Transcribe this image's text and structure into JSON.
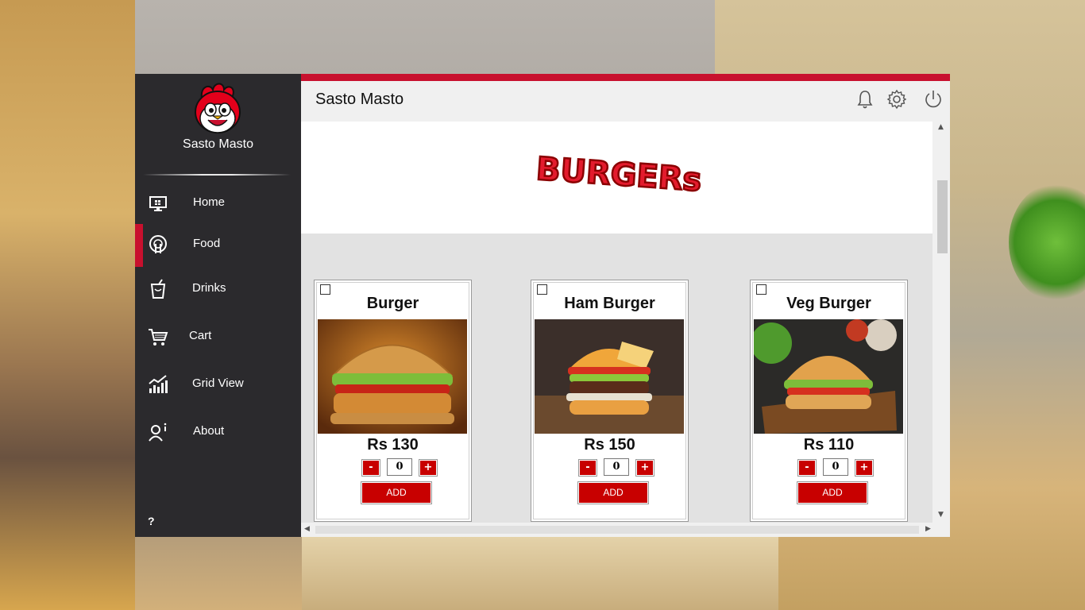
{
  "app": {
    "brand_name": "Sasto Masto",
    "header_title": "Sasto Masto",
    "accent_color": "#c8102e"
  },
  "sidebar": {
    "items": [
      {
        "label": "Home",
        "icon": "monitor-icon",
        "active": false
      },
      {
        "label": "Food",
        "icon": "food-icon",
        "active": true
      },
      {
        "label": "Drinks",
        "icon": "drink-cup-icon",
        "active": false
      },
      {
        "label": "Cart",
        "icon": "cart-icon",
        "active": false
      },
      {
        "label": "Grid View",
        "icon": "bar-chart-icon",
        "active": false
      },
      {
        "label": "About",
        "icon": "user-info-icon",
        "active": false
      }
    ],
    "help_label": "?"
  },
  "header": {
    "icons": [
      "bell-icon",
      "gear-icon",
      "power-icon"
    ]
  },
  "banner": {
    "title_text": "BURGERs"
  },
  "products": [
    {
      "name": "Burger",
      "price": "Rs 130",
      "qty": "0",
      "minus": "-",
      "plus": "+",
      "add_label": "ADD",
      "checked": false
    },
    {
      "name": "Ham Burger",
      "price": "Rs 150",
      "qty": "0",
      "minus": "-",
      "plus": "+",
      "add_label": "ADD",
      "checked": false
    },
    {
      "name": "Veg Burger",
      "price": "Rs 110",
      "qty": "0",
      "minus": "-",
      "plus": "+",
      "add_label": "ADD",
      "checked": false
    }
  ]
}
